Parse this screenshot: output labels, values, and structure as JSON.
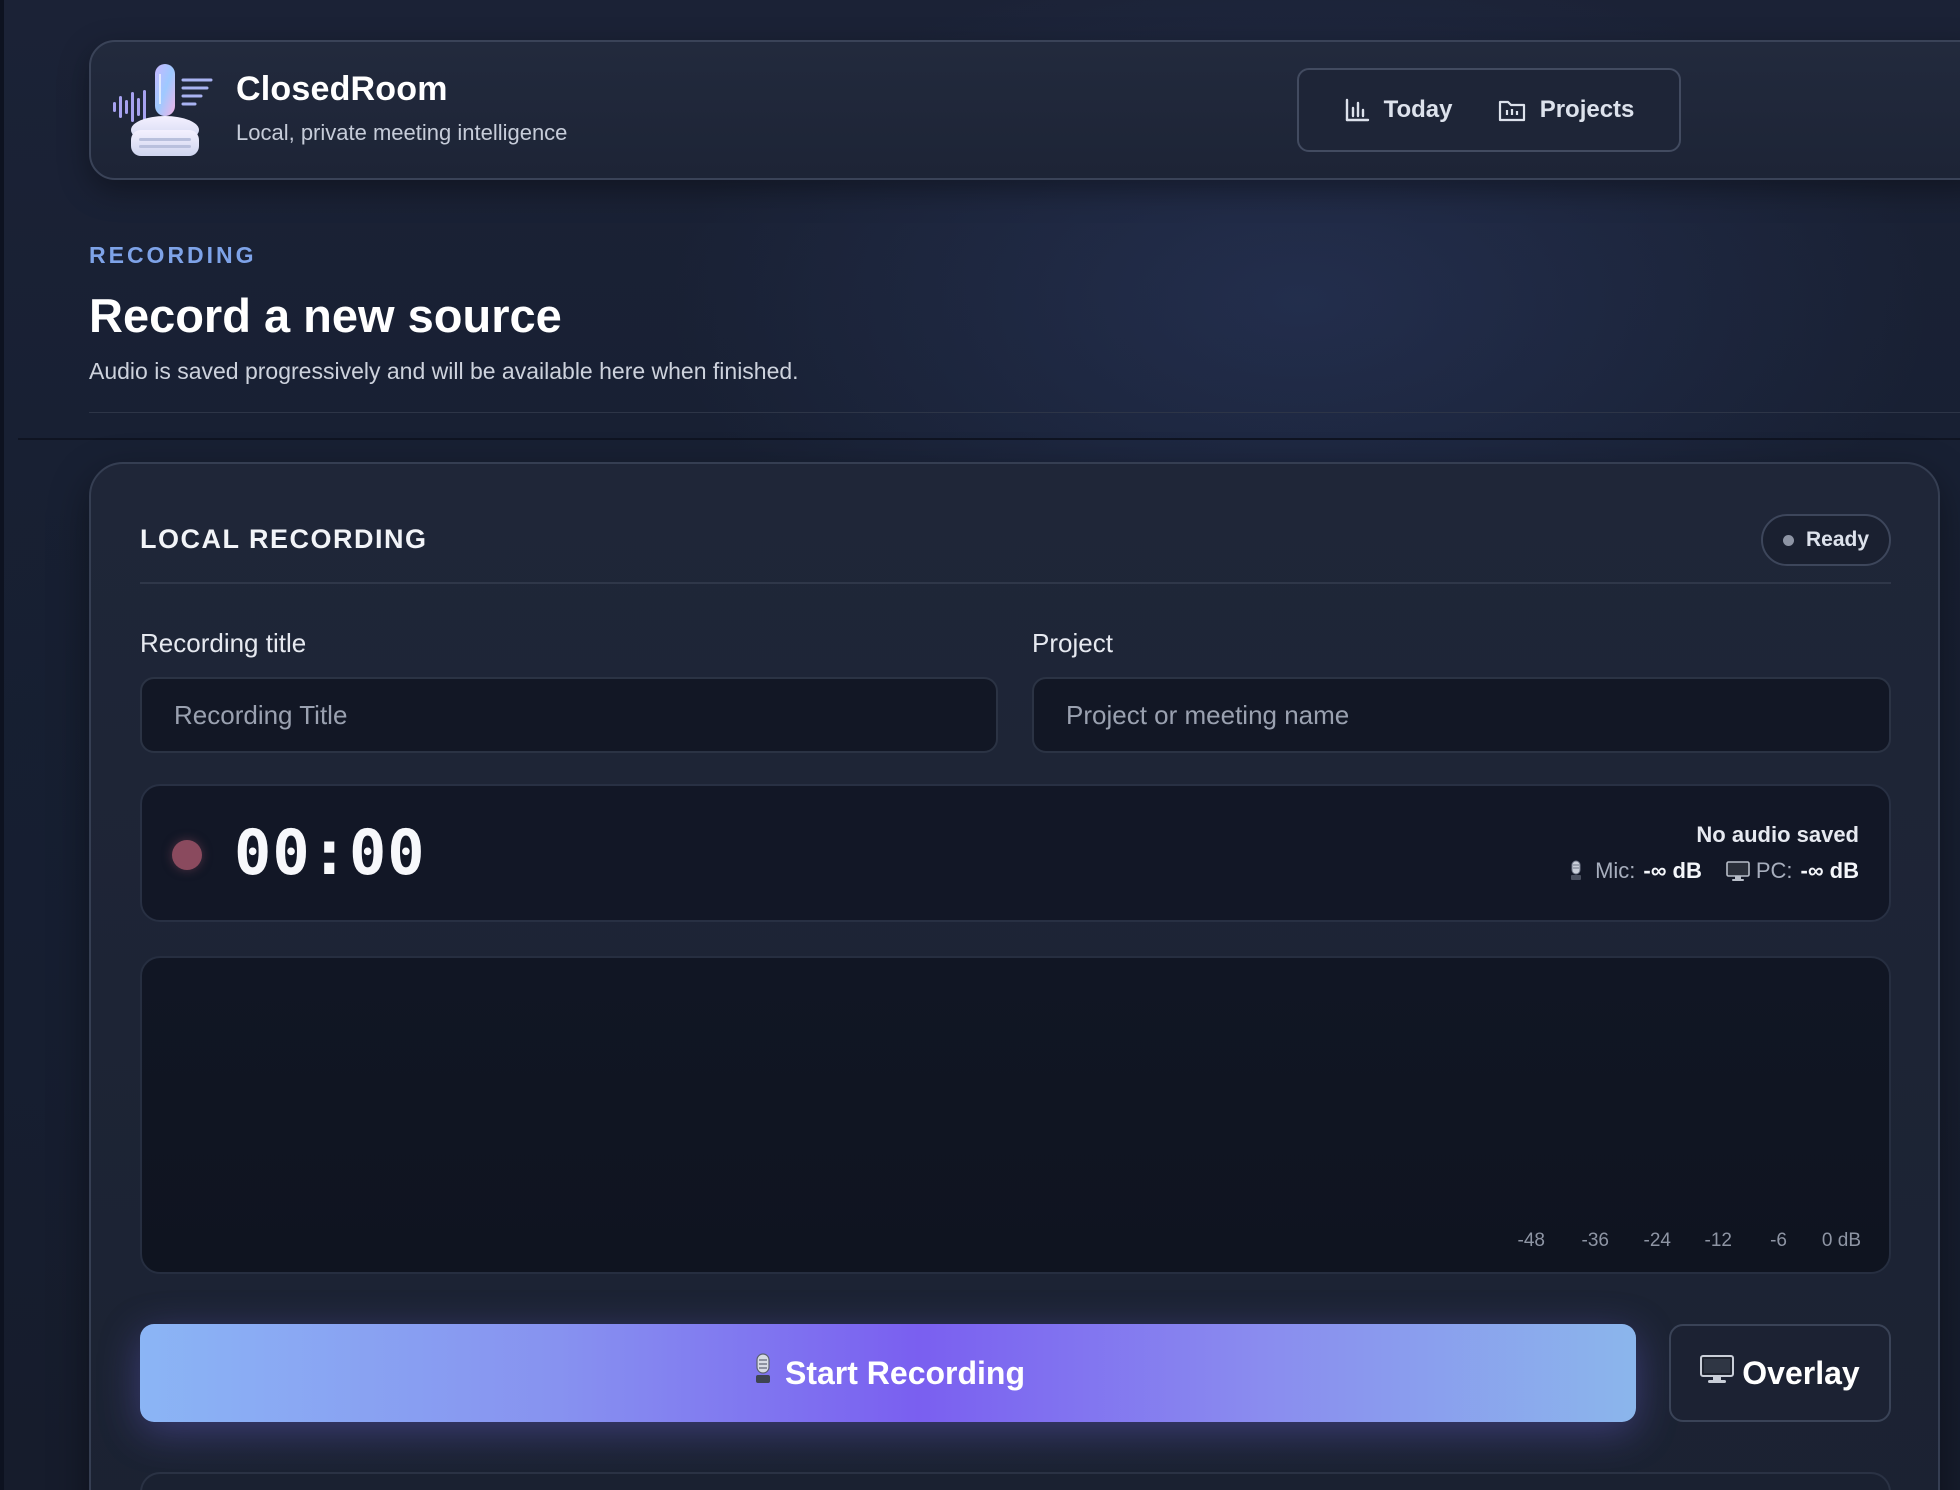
{
  "app": {
    "name": "ClosedRoom",
    "tagline": "Local, private meeting intelligence",
    "logo_icon": "microphone-logo-icon"
  },
  "nav": {
    "items": [
      {
        "label": "Today",
        "icon": "bar-chart-icon"
      },
      {
        "label": "Projects",
        "icon": "folder-icon"
      }
    ]
  },
  "page": {
    "eyebrow": "RECORDING",
    "title": "Record a new source",
    "subtitle": "Audio is saved progressively and will be available here when finished."
  },
  "card": {
    "title": "LOCAL RECORDING",
    "status": "Ready",
    "fields": {
      "title_label": "Recording title",
      "title_value": "",
      "title_placeholder": "Recording Title",
      "project_label": "Project",
      "project_value": "",
      "project_placeholder": "Project or meeting name"
    },
    "timer": {
      "elapsed": "00:00",
      "audio_status": "No audio saved",
      "mic_label": "Mic:",
      "mic_value": "-∞ dB",
      "pc_label": "PC:",
      "pc_value": "-∞ dB"
    },
    "meter": {
      "scale": [
        "-48",
        "-36",
        "-24",
        "-12",
        "-6",
        "0 dB"
      ]
    },
    "actions": {
      "start_label": "Start Recording",
      "start_icon": "microphone-icon",
      "overlay_label": "Overlay",
      "overlay_icon": "monitor-icon"
    }
  },
  "colors": {
    "accent": "#7ea3e8",
    "button_gradient_mid": "#7a5ff0",
    "recording_dot": "#8a4a5e",
    "background": "#161c2c"
  }
}
